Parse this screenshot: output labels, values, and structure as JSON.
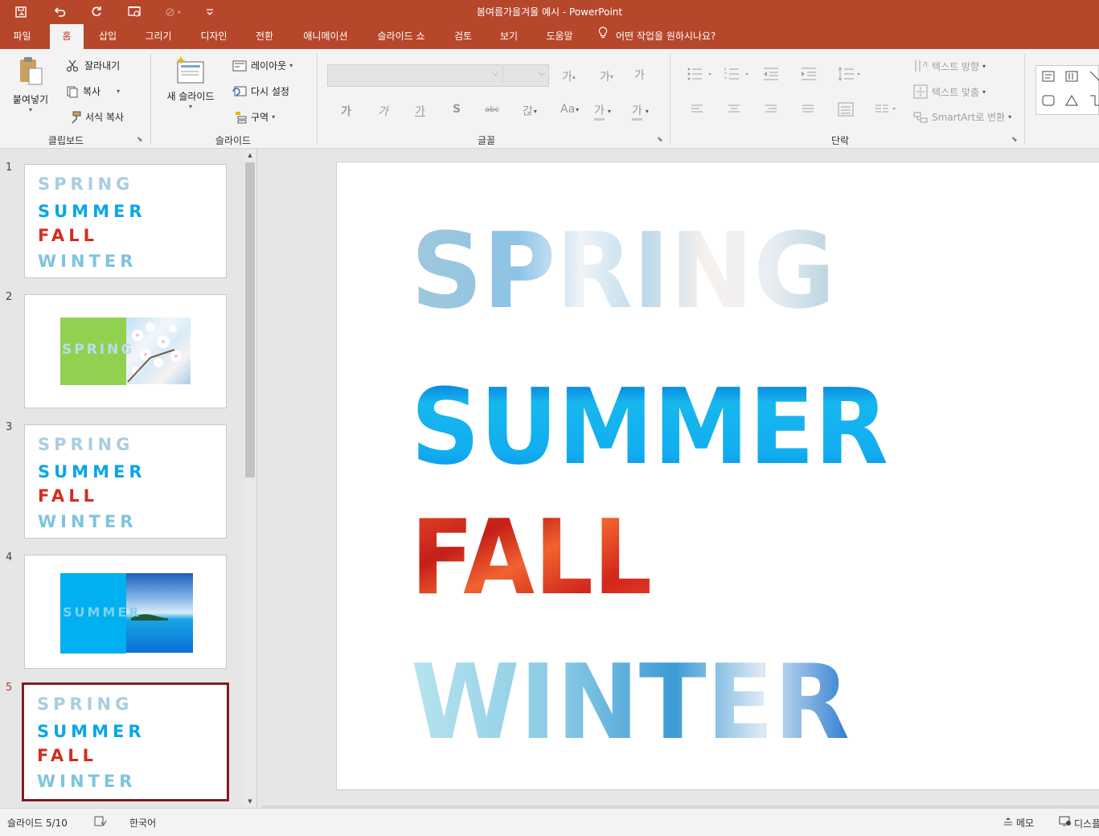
{
  "window": {
    "title": "봄여름가을겨울 예시  -  PowerPoint"
  },
  "colors": {
    "accent": "#b7472a",
    "selected_border": "#7d1d23",
    "summer": "#0aa6e8",
    "fall": "#d42d1c",
    "spring_fill": "#92d050",
    "summer_fill": "#00b0f0"
  },
  "quick_access": {
    "icons": [
      "save-icon",
      "undo-icon",
      "redo-icon",
      "start-from-beginning-icon",
      "touch-mode-icon",
      "customize-icon"
    ]
  },
  "tabs": [
    {
      "label": "파일"
    },
    {
      "label": "홈",
      "active": true
    },
    {
      "label": "삽입"
    },
    {
      "label": "그리기"
    },
    {
      "label": "디자인"
    },
    {
      "label": "전환"
    },
    {
      "label": "애니메이션"
    },
    {
      "label": "슬라이드 쇼"
    },
    {
      "label": "검토"
    },
    {
      "label": "보기"
    },
    {
      "label": "도움말"
    }
  ],
  "tell_me": "어떤 작업을 원하시나요?",
  "ribbon": {
    "clipboard": {
      "paste": "붙여넣기",
      "cut": "잘라내기",
      "copy": "복사",
      "format_painter": "서식 복사",
      "group": "클립보드"
    },
    "slides": {
      "new_slide": "새 슬라이드",
      "layout": "레이아웃",
      "reset": "다시 설정",
      "section": "구역",
      "group": "슬라이드"
    },
    "font": {
      "group": "글꼴",
      "row1": [
        "가",
        "가",
        "가"
      ],
      "row2": [
        "가",
        "가",
        "가",
        "S",
        "abc",
        "갅",
        "Aa",
        "가",
        "가"
      ]
    },
    "paragraph": {
      "group": "단락",
      "text_direction": "텍스트 방향",
      "align_text": "텍스트 맞춤",
      "smartart": "SmartArt로 변환"
    }
  },
  "slides": [
    {
      "number": "1",
      "kind": "seasons"
    },
    {
      "number": "2",
      "kind": "spring-card",
      "text": "SPRING"
    },
    {
      "number": "3",
      "kind": "seasons"
    },
    {
      "number": "4",
      "kind": "summer-card",
      "text": "SUMMER"
    },
    {
      "number": "5",
      "kind": "seasons",
      "selected": true
    }
  ],
  "seasons": [
    "SPRING",
    "SUMMER",
    "FALL",
    "WINTER"
  ],
  "status": {
    "slide": "슬라이드 5/10",
    "language": "한국어",
    "notes": "메모",
    "display": "디스플"
  }
}
